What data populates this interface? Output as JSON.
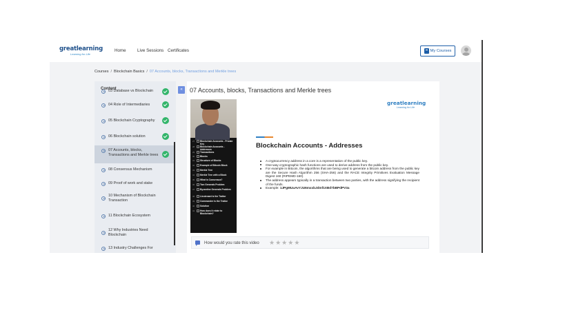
{
  "header": {
    "logo_main": "greatlearning",
    "logo_tagline": "Learning for Life",
    "nav": [
      "Home",
      "Live Sessions",
      "Certificates"
    ],
    "my_courses_label": "My Courses"
  },
  "breadcrumb": [
    "Courses",
    "Blockchain Basics",
    "07 Accounts, blocks, Transactions and Merkle trees"
  ],
  "sidebar": {
    "title": "Content",
    "items": [
      {
        "label": "03 Database vs Blockchain",
        "completed": true
      },
      {
        "label": "04 Role of Intermediaries",
        "completed": true
      },
      {
        "label": "05 Blockchain Cryptography",
        "completed": true
      },
      {
        "label": "06 Blockchain solution",
        "completed": true
      },
      {
        "label": "07 Accounts, blocks, Transactions and Merkle trees",
        "completed": true,
        "active": true
      },
      {
        "label": "08 Consensus Mechanism",
        "completed": false
      },
      {
        "label": "09 Proof of work and stake",
        "completed": false
      },
      {
        "label": "10 Mechanism of Blockchain Transaction",
        "completed": false
      },
      {
        "label": "11 Blockchain Ecosystem",
        "completed": false
      },
      {
        "label": "12 Why Industries Need Blockchain",
        "completed": false
      },
      {
        "label": "13 Industry Challenges For",
        "completed": false
      }
    ]
  },
  "main": {
    "title": "07 Accounts, blocks, Transactions and Merkle trees",
    "slide": {
      "logo_main": "greatlearning",
      "logo_tagline": "Learning for Life",
      "heading": "Blockchain Accounts - Addresses",
      "bullets": [
        "A cryptocurrency address in a core is a representation of the public key.",
        "One-way cryptographic hash functions are used to derive address from the public key.",
        "For example in Bitcoin, the algorithms that are being used to generate a bitcoin address from the public key are the Secure Hash Algorithm 256 (SHA-256) and the RACE Integrity Primitives Evaluation Message Digest 160 (RIPEMD-160)",
        "The address appears typically in a transaction between two parties, with the address signifying the recipient of the funds."
      ],
      "example_label": "Example: ",
      "example_value": "1JPgMUuAvYJU6mxxbJdmf1XBd7bBPdPV3a",
      "toc": [
        {
          "num": "27",
          "text": "Blockchain Accounts - Private Key"
        },
        {
          "num": "28",
          "text": "Blockchain Accounts - Addresses"
        },
        {
          "num": "29",
          "text": "Transactions"
        },
        {
          "num": "30",
          "text": "Blocks"
        },
        {
          "num": "31",
          "text": "Structure of Blocks"
        },
        {
          "num": "32",
          "text": "Example of Bitcoin Block"
        },
        {
          "num": "33",
          "text": "Merkle Tree"
        },
        {
          "num": "34",
          "text": "Merkle Tree with a Block"
        },
        {
          "num": "35",
          "text": "What is Consensus?"
        },
        {
          "num": "36",
          "text": "Two Generals Problem"
        },
        {
          "num": "37",
          "text": "Byzantine Generals Problem"
        },
        {
          "num": "38",
          "text": "Lieutenant is the Traitor"
        },
        {
          "num": "39",
          "text": "Commander is the Traitor"
        },
        {
          "num": "40",
          "text": "Solution"
        },
        {
          "num": "41",
          "text": "How does it relate to Blockchain?"
        }
      ]
    },
    "rating": {
      "question": "How would you rate this video",
      "stars_max": 5,
      "stars_selected": 0
    }
  },
  "colors": {
    "brand_blue": "#1d4f8a",
    "accent_blue": "#6f8fe0",
    "complete_green": "#33b56b",
    "breadcrumb_current": "#6f9ee0"
  }
}
